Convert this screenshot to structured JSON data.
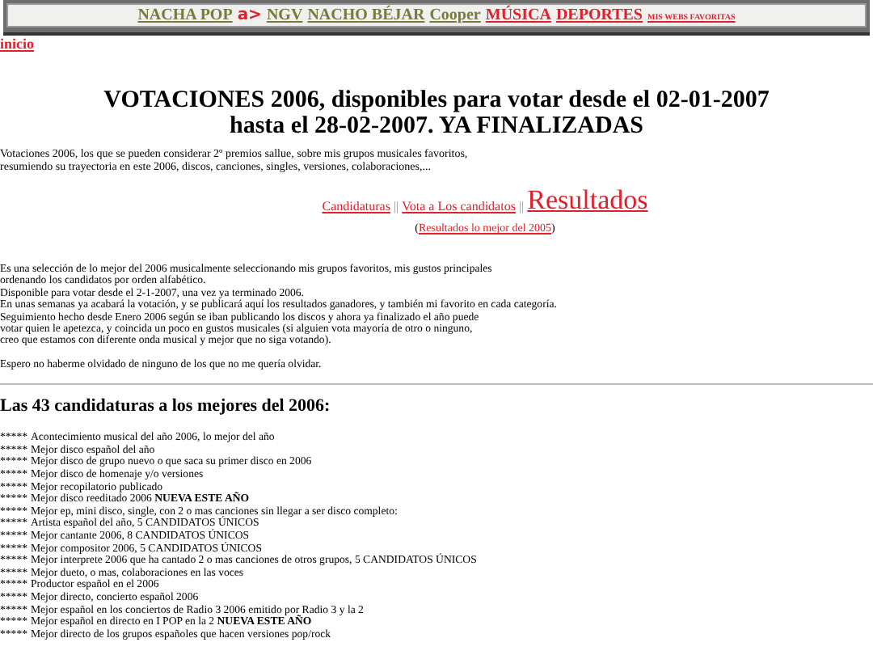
{
  "top_bar": {
    "items": [
      {
        "kind": "link",
        "text": "NACHA POP",
        "color": "#7a7a3a"
      },
      {
        "kind": "logo",
        "text": "a>",
        "color": "#e0202a"
      },
      {
        "kind": "link",
        "text": "NGV",
        "color": "#7a7a3a"
      },
      {
        "kind": "link",
        "text": "NACHO BÉJAR",
        "color": "#7a7a3a"
      },
      {
        "kind": "link",
        "text": "Cooper",
        "color": "#7a7a3a"
      },
      {
        "kind": "link",
        "text": "MÚSICA",
        "color": "#e0202a"
      },
      {
        "kind": "link",
        "text": "DEPORTES",
        "color": "#e0202a"
      },
      {
        "kind": "small",
        "text": "MIS WEBS FAVORITAS",
        "color": "#e0202a"
      }
    ]
  },
  "home_link": "inicio",
  "title_lines": [
    "VOTACIONES 2006, disponibles para votar desde el 02-01-2007",
    "hasta el 28-02-2007. YA FINALIZADAS"
  ],
  "intro_lines": [
    "Votaciones 2006, los que se pueden considerar 2º premios sallue, sobre mis grupos musicales favoritos,",
    "resumiendo su trayectoria en este 2006, discos, canciones, singles, versiones, colaboraciones,..."
  ],
  "nav_links": [
    {
      "text": "Candidaturas",
      "selected": false
    },
    {
      "text": "Vota a Los candidatos",
      "selected": false
    },
    {
      "text": "Resultados",
      "selected": true
    }
  ],
  "nav_separator": "||",
  "previous_results": {
    "open": "(",
    "link": "Resultados lo mejor del 2005",
    "close": ")"
  },
  "description_lines": [
    "Es una selección de lo mejor del 2006 musicalmente seleccionando mis grupos favoritos, mis gustos principales",
    "ordenando los candidatos por orden alfabético.",
    "Disponible para votar desde el 2-1-2007, una vez ya terminado 2006.",
    "En unas semanas ya acabará la votación, y se publicará aquí los resultados ganadores, y también mi favorito en cada categoría.",
    "Seguimiento hecho desde Enero 2006 según se iban publicando los discos y ahora ya finalizado el año puede",
    "votar quien le apetezca, y coincida un poco en gustos musicales (si alguien vota mayoría de otro o ninguno,",
    "creo que estamos con diferente onda musical y mejor que no siga votando)."
  ],
  "closing_note": "Espero no haberme olvidado de ninguno de los que no me quería olvidar.",
  "candidates_heading": "Las 43 candidaturas a los mejores del 2006:",
  "categories": [
    {
      "bullet": "*****",
      "text": "Acontecimiento musical del año 2006, lo mejor del año"
    },
    {
      "bullet": "*****",
      "text": "Mejor disco español del año"
    },
    {
      "bullet": "*****",
      "text": "Mejor disco de grupo nuevo o que saca su primer disco en 2006"
    },
    {
      "bullet": "*****",
      "text": "Mejor disco de homenaje y/o versiones"
    },
    {
      "bullet": "*****",
      "text": "Mejor recopilatorio publicado"
    },
    {
      "bullet": "*****",
      "text": "Mejor disco reeditado 2006 **NUEVA ESTE AÑO**"
    },
    {
      "bullet": "*****",
      "text": "Mejor ep, mini disco, single, con 2 o mas canciones sin llegar a ser disco completo:"
    },
    {
      "bullet": "*****",
      "text": "Artista español del año, 5 CANDIDATOS ÚNICOS"
    },
    {
      "bullet": "*****",
      "text": "Mejor cantante 2006, 8 CANDIDATOS ÚNICOS"
    },
    {
      "bullet": "*****",
      "text": "Mejor compositor 2006, 5 CANDIDATOS ÚNICOS"
    },
    {
      "bullet": "*****",
      "text": "Mejor interprete 2006 que ha cantado 2 o mas canciones de otros grupos, 5 CANDIDATOS ÚNICOS"
    },
    {
      "bullet": "*****",
      "text": "Mejor dueto, o mas, colaboraciones en las voces"
    },
    {
      "bullet": "*****",
      "text": "Productor español en el 2006"
    },
    {
      "bullet": "*****",
      "text": "Mejor directo, concierto español 2006"
    },
    {
      "bullet": "*****",
      "text": "Mejor español en los conciertos de Radio 3 2006 emitido por Radio 3 y la 2"
    },
    {
      "bullet": "*****",
      "text": "Mejor español en directo en I POP en la 2 **NUEVA ESTE AÑO**"
    },
    {
      "bullet": "*****",
      "text": "Mejor directo de los grupos españoles que hacen versiones pop/rock"
    }
  ]
}
